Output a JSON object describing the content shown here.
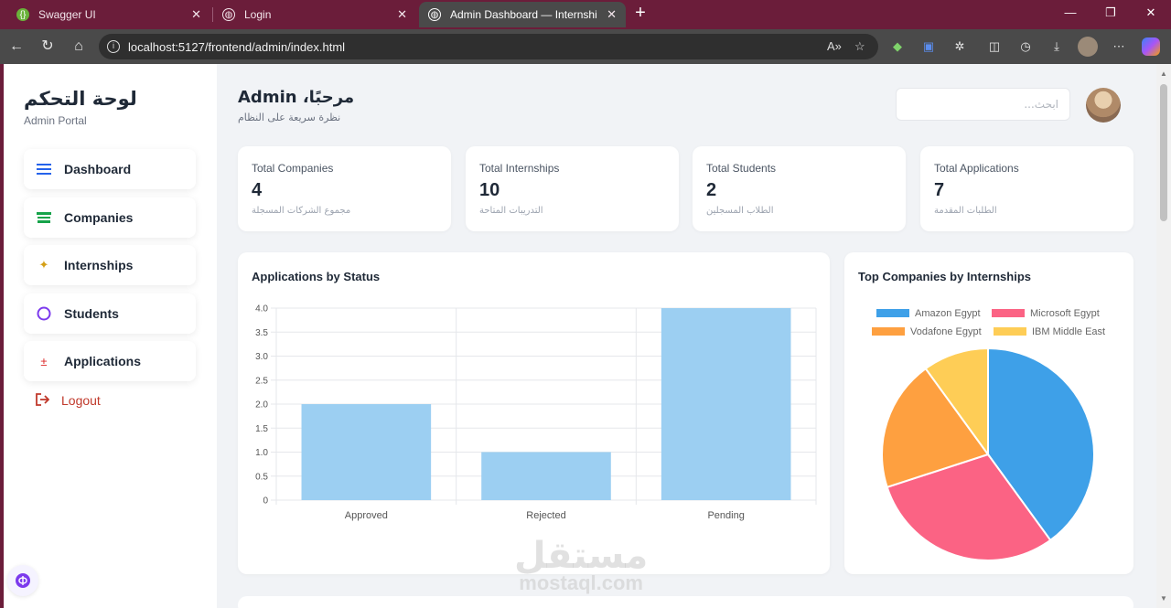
{
  "browser": {
    "tabs": [
      {
        "title": "Swagger UI",
        "icon": "swagger-icon"
      },
      {
        "title": "Login",
        "icon": "globe-icon"
      },
      {
        "title": "Admin Dashboard — Internship P",
        "icon": "globe-icon"
      }
    ],
    "url": "localhost:5127/frontend/admin/index.html"
  },
  "sidebar": {
    "brand": "لوحة التحكم",
    "subtitle": "Admin Portal",
    "items": [
      {
        "label": "Dashboard",
        "icon": "menu-icon",
        "color": "#2563eb"
      },
      {
        "label": "Companies",
        "icon": "building-icon",
        "color": "#16a34a"
      },
      {
        "label": "Internships",
        "icon": "sparkle-icon",
        "color": "#d4a017"
      },
      {
        "label": "Students",
        "icon": "circle-icon",
        "color": "#7c3aed"
      },
      {
        "label": "Applications",
        "icon": "pin-icon",
        "color": "#dc2626"
      }
    ],
    "logout": "Logout"
  },
  "header": {
    "greeting": "مرحبًا، Admin",
    "subtitle": "نظرة سريعة على النظام",
    "search_placeholder": "ابحث..."
  },
  "stats": [
    {
      "label": "Total Companies",
      "value": "4",
      "sub": "مجموع الشركات المسجلة"
    },
    {
      "label": "Total Internships",
      "value": "10",
      "sub": "التدريبات المتاحة"
    },
    {
      "label": "Total Students",
      "value": "2",
      "sub": "الطلاب المسجلين"
    },
    {
      "label": "Total Applications",
      "value": "7",
      "sub": "الطلبات المقدمة"
    }
  ],
  "watermark": {
    "arabic": "مستقل",
    "latin": "mostaql.com"
  },
  "chart_data": [
    {
      "type": "bar",
      "title": "Applications by Status",
      "categories": [
        "Approved",
        "Rejected",
        "Pending"
      ],
      "values": [
        2,
        1,
        4
      ],
      "ylim": [
        0,
        4
      ],
      "yticks": [
        "0",
        "0.5",
        "1.0",
        "1.5",
        "2.0",
        "2.5",
        "3.0",
        "3.5",
        "4.0"
      ],
      "grid": true,
      "color": "#9ccff2"
    },
    {
      "type": "pie",
      "title": "Top Companies by Internships",
      "legend_position": "top",
      "series": [
        {
          "name": "Amazon Egypt",
          "value": 4,
          "color": "#3ea0e8"
        },
        {
          "name": "Microsoft Egypt",
          "value": 3,
          "color": "#fb6384"
        },
        {
          "name": "Vodafone Egypt",
          "value": 2,
          "color": "#fea040"
        },
        {
          "name": "IBM Middle East",
          "value": 1,
          "color": "#fecd56"
        }
      ]
    }
  ]
}
